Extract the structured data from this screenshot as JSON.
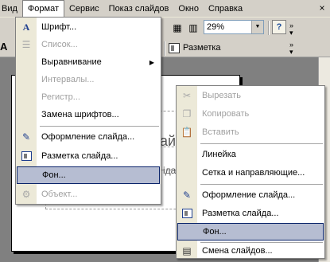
{
  "menubar": {
    "items": [
      {
        "label": "Вид"
      },
      {
        "label": "Формат"
      },
      {
        "label": "Сервис"
      },
      {
        "label": "Показ слайдов"
      },
      {
        "label": "Окно"
      },
      {
        "label": "Справка"
      }
    ],
    "close_glyph": "×"
  },
  "toolbar": {
    "zoom_value": "29%",
    "layout_label": "Разметка",
    "help_glyph": "?"
  },
  "slide": {
    "visible_text": "айде",
    "visible_text_2": "іда"
  },
  "format_menu": {
    "items": [
      {
        "label": "Шрифт...",
        "icon": "font-icon",
        "enabled": true
      },
      {
        "label": "Список...",
        "icon": "list-icon",
        "enabled": false
      },
      {
        "label": "Выравнивание",
        "icon": "",
        "enabled": true,
        "submenu": true
      },
      {
        "label": "Интервалы...",
        "icon": "",
        "enabled": false
      },
      {
        "label": "Регистр...",
        "icon": "",
        "enabled": false
      },
      {
        "label": "Замена шрифтов...",
        "icon": "",
        "enabled": true
      },
      {
        "label": "Оформление слайда...",
        "icon": "slide-design-icon",
        "enabled": true
      },
      {
        "label": "Разметка слайда...",
        "icon": "slide-layout-icon",
        "enabled": true
      },
      {
        "label": "Фон...",
        "icon": "",
        "enabled": true,
        "highlighted": true
      },
      {
        "label": "Объект...",
        "icon": "object-icon",
        "enabled": false
      }
    ]
  },
  "context_menu": {
    "items": [
      {
        "label": "Вырезать",
        "icon": "scissors-icon",
        "enabled": false
      },
      {
        "label": "Копировать",
        "icon": "copy-icon",
        "enabled": false
      },
      {
        "label": "Вставить",
        "icon": "paste-icon",
        "enabled": false
      },
      {
        "label": "Линейка",
        "icon": "",
        "enabled": true
      },
      {
        "label": "Сетка и направляющие...",
        "icon": "",
        "enabled": true
      },
      {
        "label": "Оформление слайда...",
        "icon": "slide-design-icon",
        "enabled": true
      },
      {
        "label": "Разметка слайда...",
        "icon": "slide-layout-icon",
        "enabled": true
      },
      {
        "label": "Фон...",
        "icon": "",
        "enabled": true,
        "highlighted": true
      },
      {
        "label": "Смена слайдов...",
        "icon": "slide-transition-icon",
        "enabled": true
      }
    ]
  },
  "colors": {
    "menu_highlight": "#b6bdd2",
    "menu_highlight_border": "#0a246a",
    "icon_column": "#ece9d8",
    "disabled_text": "#a0a0a0"
  }
}
